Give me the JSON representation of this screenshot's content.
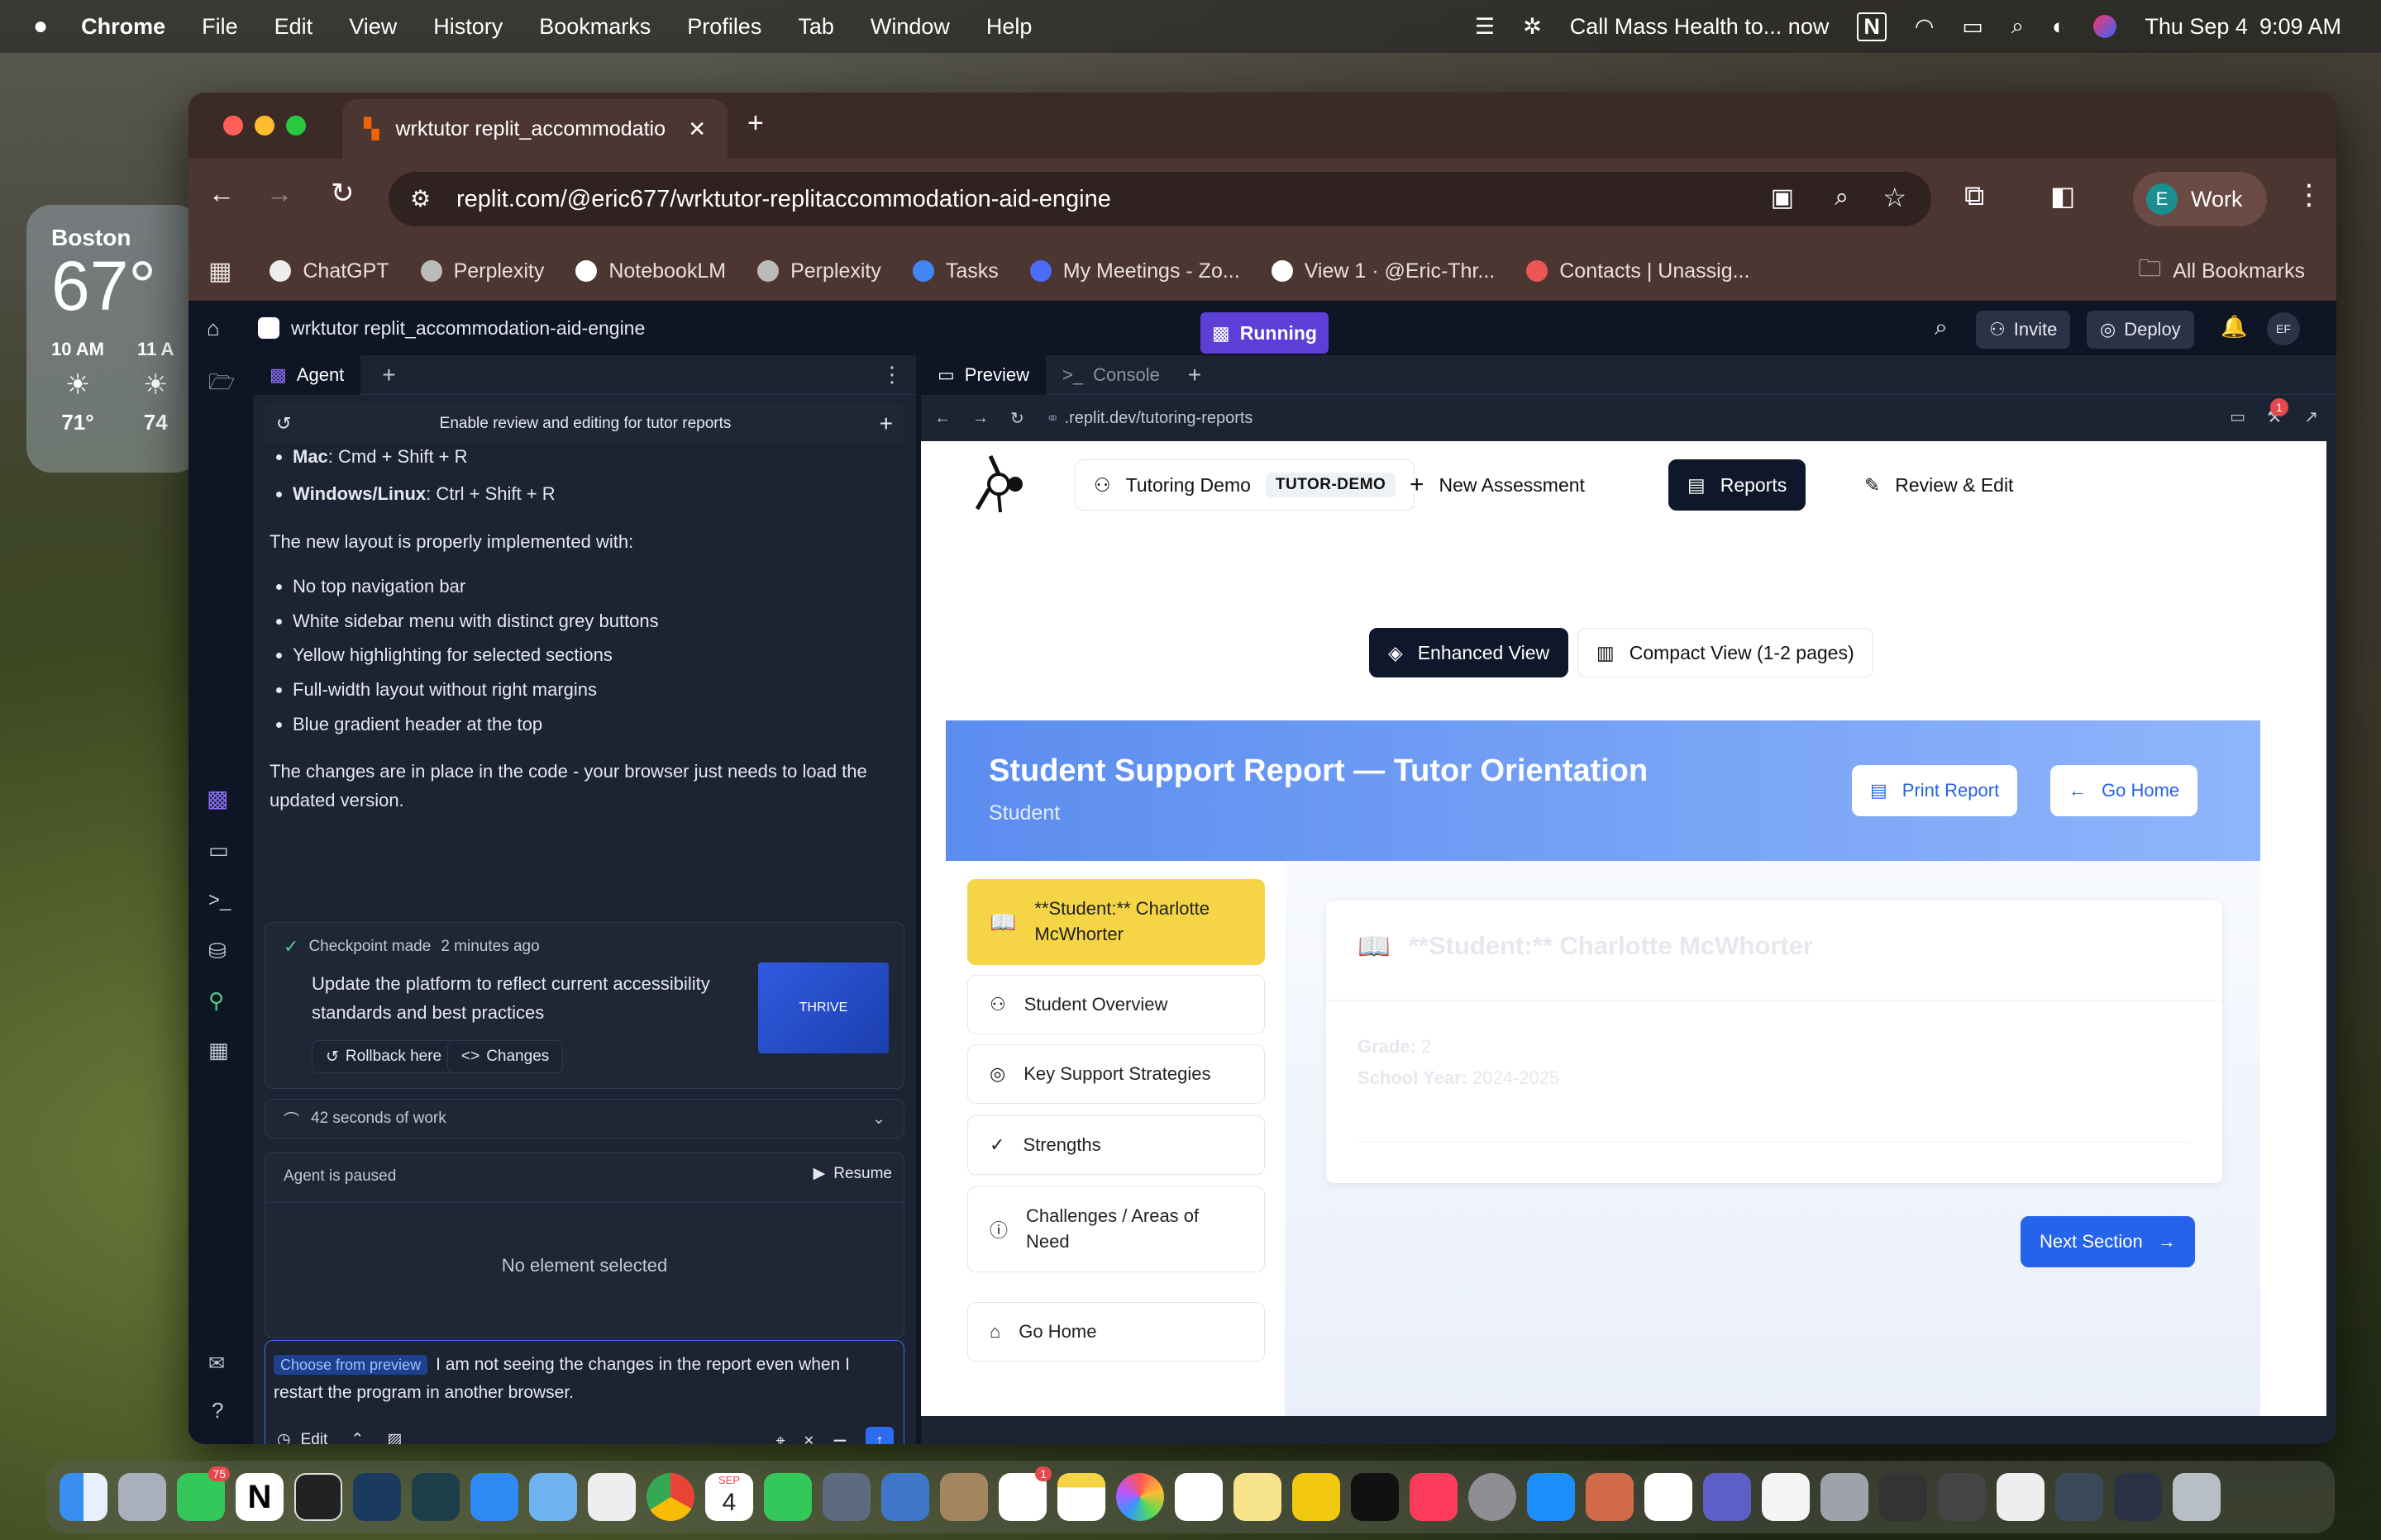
{
  "menubar": {
    "app": "Chrome",
    "items": [
      "File",
      "Edit",
      "View",
      "History",
      "Bookmarks",
      "Profiles",
      "Tab",
      "Window",
      "Help"
    ],
    "notification": "Call Mass Health to... now",
    "date": "Thu Sep 4",
    "time": "9:09 AM"
  },
  "weather": {
    "city": "Boston",
    "temp": "67°",
    "hours": [
      {
        "label": "10 AM",
        "temp": "71°"
      },
      {
        "label": "11 A",
        "temp": "74"
      }
    ]
  },
  "browser": {
    "tab_title": "wrktutor replit_accommodatio",
    "url": "replit.com/@eric677/wrktutor-replitaccommodation-aid-engine",
    "profile_initial": "E",
    "profile_label": "Work",
    "bookmarks": [
      "ChatGPT",
      "Perplexity",
      "NotebookLM",
      "Perplexity",
      "Tasks",
      "My Meetings - Zo...",
      "View 1 · @Eric-Thr...",
      "Contacts | Unassig..."
    ],
    "all_bookmarks": "All Bookmarks"
  },
  "replit": {
    "project_name": "wrktutor replit_accommodation-aid-engine",
    "status": "Running",
    "invite": "Invite",
    "deploy": "Deploy",
    "avatar": "EF",
    "agent_tab": "Agent",
    "preview_tab": "Preview",
    "console_tab": "Console",
    "thread_title": "Enable review and editing for tutor reports",
    "shortcut_mac_label": "Mac",
    "shortcut_mac": ": Cmd + Shift + R",
    "shortcut_win_label": "Windows/Linux",
    "shortcut_win": ": Ctrl + Shift + R",
    "layout_intro": "The new layout is properly implemented with:",
    "layout_items": [
      "No top navigation bar",
      "White sidebar menu with distinct grey buttons",
      "Yellow highlighting for selected sections",
      "Full-width layout without right margins",
      "Blue gradient header at the top"
    ],
    "changes_text": "The changes are in place in the code - your browser just needs to load the updated version.",
    "checkpoint_label": "Checkpoint made",
    "checkpoint_time": "2 minutes ago",
    "checkpoint_desc": "Update the platform to reflect current accessibility standards and best practices",
    "thumb_text": "THRIVE",
    "rollback": "Rollback here",
    "changes_btn": "Changes",
    "work_time": "42 seconds of work",
    "paused": "Agent is paused",
    "resume": "Resume",
    "no_element": "No element selected",
    "choose_badge": "Choose from preview",
    "input_text": "I am not seeing the changes in the report even when I restart the program in another browser.",
    "edit_mode": "Edit",
    "preview_url": ".replit.dev/tutoring-reports",
    "notif_count": "1"
  },
  "app": {
    "tutoring_demo": "Tutoring Demo",
    "demo_badge": "TUTOR-DEMO",
    "new_assessment": "New Assessment",
    "reports": "Reports",
    "review_edit": "Review & Edit",
    "enhanced_view": "Enhanced View",
    "compact_view": "Compact View (1-2 pages)",
    "report_title": "Student Support Report — Tutor Orientation",
    "report_subtitle": "Student",
    "print_report": "Print Report",
    "go_home_header": "Go Home",
    "sidebar": [
      "**Student:** Charlotte McWhorter",
      "Student Overview",
      "Key Support Strategies",
      "Strengths",
      "Challenges / Areas of Need"
    ],
    "sidebar_home": "Go Home",
    "section_title": "**Student:** Charlotte McWhorter",
    "grade_label": "Grade:",
    "grade_value": " 2",
    "year_label": "School Year:",
    "year_value": " 2024-2025",
    "next_section": "Next Section"
  },
  "dock": {
    "calendar_month": "SEP",
    "calendar_day": "4",
    "messages_badge": "75",
    "reminders_badge": "1"
  },
  "colors": {
    "accent": "#2563eb",
    "selected": "#f5d445",
    "running": "#5b3fd6",
    "header_gradient_start": "#5b8def",
    "header_gradient_end": "#8fb5fb"
  }
}
